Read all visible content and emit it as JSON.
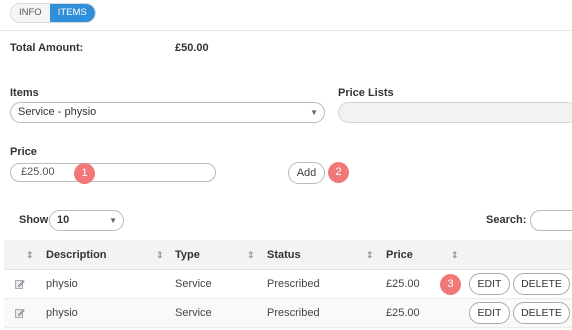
{
  "tabs": [
    {
      "label": "INFO",
      "active": false
    },
    {
      "label": "ITEMS",
      "active": true
    }
  ],
  "summary": {
    "total_label": "Total Amount:",
    "total_value": "£50.00"
  },
  "form": {
    "items_label": "Items",
    "items_selected": "Service - physio",
    "price_lists_label": "Price Lists",
    "price_lists_selected": "",
    "price_label": "Price",
    "price_value": "£25.00",
    "add_label": "Add"
  },
  "annotations": [
    "1",
    "2",
    "3"
  ],
  "table_controls": {
    "show_label": "Show",
    "show_value": "10",
    "search_label": "Search:",
    "search_value": ""
  },
  "table": {
    "columns": [
      "",
      "Description",
      "Type",
      "Status",
      "Price",
      ""
    ],
    "rows": [
      {
        "description": "physio",
        "type": "Service",
        "status": "Prescribed",
        "price": "£25.00",
        "edit": "EDIT",
        "delete": "DELETE"
      },
      {
        "description": "physio",
        "type": "Service",
        "status": "Prescribed",
        "price": "£25.00",
        "edit": "EDIT",
        "delete": "DELETE"
      }
    ]
  },
  "colors": {
    "accent": "#2f8fd8",
    "annotation": "#f07878"
  },
  "icons": {
    "sort": "sort-icon",
    "row_edit": "pencil-icon",
    "dropdown": "chevron-down-icon"
  }
}
